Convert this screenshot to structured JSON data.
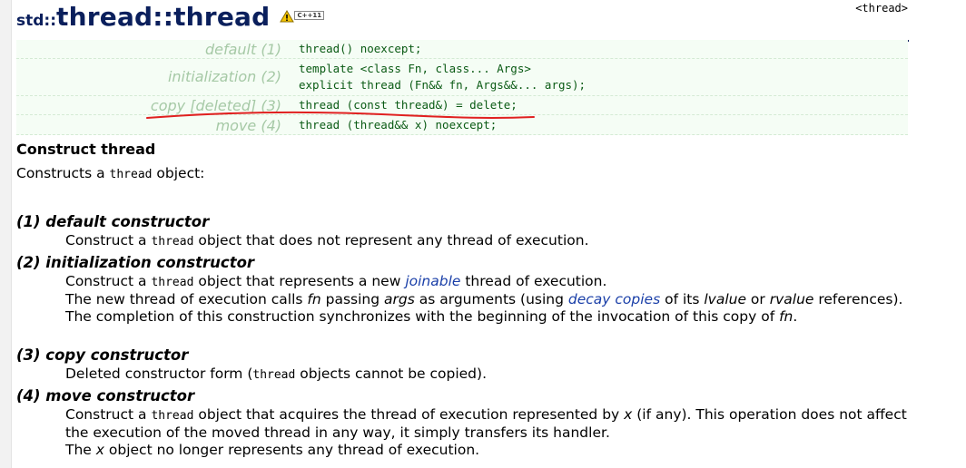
{
  "title": {
    "ns": "std",
    "sep1": "::",
    "class_name": "thread",
    "sep2": "::",
    "member": "thread"
  },
  "badge": "C++11",
  "header_ref": "<thread>",
  "signatures": [
    {
      "label": "default (1)",
      "code": "thread() noexcept;"
    },
    {
      "label": "initialization (2)",
      "code": "template <class Fn, class... Args>\nexplicit thread (Fn&& fn, Args&&... args);"
    },
    {
      "label": "copy [deleted] (3)",
      "code": "thread (const thread&) = delete;"
    },
    {
      "label": "move (4)",
      "code": "thread (thread&& x) noexcept;"
    }
  ],
  "section_title": "Construct thread",
  "intro": {
    "before": "Constructs a ",
    "code": "thread",
    "after": " object:"
  },
  "items": [
    {
      "term": "(1) default constructor",
      "lines": [
        {
          "a": "Construct a ",
          "code": "thread",
          "b": " object that does not represent any thread of execution."
        }
      ]
    },
    {
      "term": "(2) initialization constructor",
      "l1": {
        "a": "Construct a ",
        "code": "thread",
        "b": " object that represents a new ",
        "link": "joinable",
        "c": " thread of execution."
      },
      "l2": {
        "a": "The new thread of execution calls ",
        "fn": "fn",
        "b": " passing ",
        "args": "args",
        "c": " as arguments (using ",
        "link": "decay copies",
        "d": " of its ",
        "lvalue": "lvalue",
        "e": " or ",
        "rvalue": "rvalue",
        "f": " references)."
      },
      "l3": {
        "a": "The completion of this construction synchronizes with the beginning of the invocation of this copy of ",
        "fn": "fn",
        "b": "."
      }
    },
    {
      "term": "(3) copy constructor",
      "l1": {
        "a": "Deleted constructor form (",
        "code": "thread",
        "b": " objects cannot be copied)."
      }
    },
    {
      "term": "(4) move constructor",
      "l1": {
        "a": "Construct a ",
        "code": "thread",
        "b": " object that acquires the thread of execution represented by ",
        "x": "x",
        "c": " (if any). This operation does not affect the execution of the moved thread in any way, it simply transfers its handler."
      },
      "l2": {
        "a": "The ",
        "x": "x",
        "b": " object no longer represents any thread of execution."
      }
    }
  ],
  "colors": {
    "title": "#0a1f5c",
    "label": "#a6c9a6",
    "code": "#0a5a14",
    "link": "#1a3fa8",
    "annotation": "#e02020"
  }
}
